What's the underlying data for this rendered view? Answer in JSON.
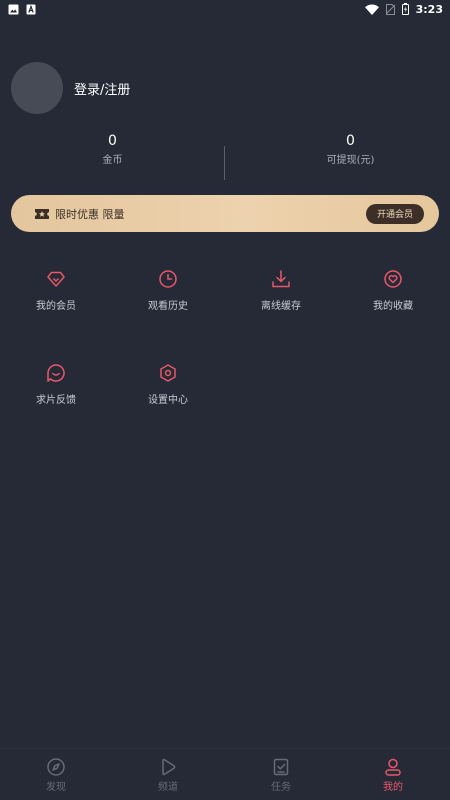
{
  "status_bar": {
    "time": "3:23"
  },
  "profile": {
    "login_label": "登录/注册"
  },
  "stats": [
    {
      "value": "0",
      "label": "金币"
    },
    {
      "value": "0",
      "label": "可提现(元)"
    }
  ],
  "promo": {
    "text": "限时优惠 限量",
    "button": "开通会员"
  },
  "menu": [
    {
      "label": "我的会员",
      "icon": "diamond-icon"
    },
    {
      "label": "观看历史",
      "icon": "clock-icon"
    },
    {
      "label": "离线缓存",
      "icon": "download-icon"
    },
    {
      "label": "我的收藏",
      "icon": "heart-icon"
    },
    {
      "label": "求片反馈",
      "icon": "chat-bubble-icon"
    },
    {
      "label": "设置中心",
      "icon": "settings-hexagon-icon"
    }
  ],
  "bottom_nav": [
    {
      "label": "发现",
      "icon": "compass-icon"
    },
    {
      "label": "频道",
      "icon": "play-icon"
    },
    {
      "label": "任务",
      "icon": "task-check-icon"
    },
    {
      "label": "我的",
      "icon": "user-icon",
      "active": true
    }
  ],
  "colors": {
    "background": "#252a36",
    "accent": "#e9576a",
    "promo_gold": "#e8cba2",
    "inactive_nav": "#666b77"
  }
}
